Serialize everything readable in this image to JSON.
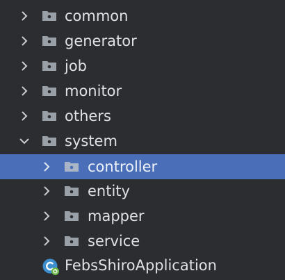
{
  "project_tree": {
    "packages": [
      {
        "label": "common",
        "expanded": false
      },
      {
        "label": "generator",
        "expanded": false
      },
      {
        "label": "job",
        "expanded": false
      },
      {
        "label": "monitor",
        "expanded": false
      },
      {
        "label": "others",
        "expanded": false
      },
      {
        "label": "system",
        "expanded": true
      }
    ],
    "system_children": [
      {
        "label": "controller",
        "expanded": false,
        "selected": true
      },
      {
        "label": "entity",
        "expanded": false
      },
      {
        "label": "mapper",
        "expanded": false
      },
      {
        "label": "service",
        "expanded": false
      }
    ],
    "app_class": {
      "label": "FebsShiroApplication",
      "icon": "spring-boot-class-icon"
    }
  },
  "colors": {
    "background": "#2b2d30",
    "selection": "#4a6eb7",
    "text": "#dfe1e5",
    "folder_icon": "#9aa0a8",
    "chevron": "#c9ccd1",
    "class_icon": "#3b8fd0",
    "spring_badge": "#6cb84a"
  }
}
